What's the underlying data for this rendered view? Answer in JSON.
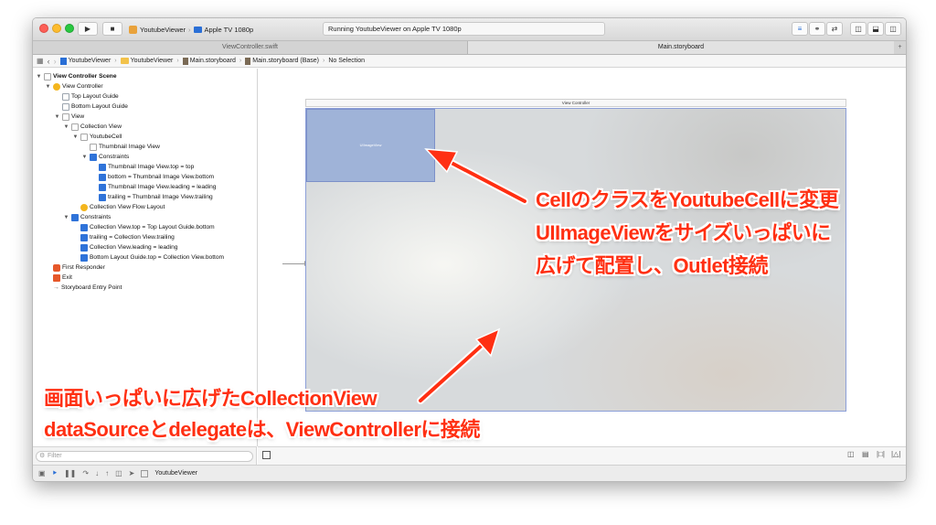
{
  "toolbar": {
    "scheme_app": "YoutubeViewer",
    "scheme_device": "Apple TV 1080p",
    "activity_text": "Running YoutubeViewer on Apple TV 1080p"
  },
  "tabs": [
    {
      "label": "ViewController.swift",
      "active": false
    },
    {
      "label": "Main.storyboard",
      "active": true
    }
  ],
  "jumpbar": {
    "crumbs": [
      "YoutubeViewer",
      "YoutubeViewer",
      "Main.storyboard",
      "Main.storyboard (Base)",
      "No Selection"
    ]
  },
  "outline": {
    "items": [
      {
        "label": "View Controller Scene",
        "icon": "scene-icon"
      },
      {
        "label": "View Controller",
        "icon": "view-controller-icon"
      },
      {
        "label": "Top Layout Guide",
        "icon": "layout-guide-icon"
      },
      {
        "label": "Bottom Layout Guide",
        "icon": "layout-guide-icon"
      },
      {
        "label": "View",
        "icon": "view-icon"
      },
      {
        "label": "Collection View",
        "icon": "collection-view-icon"
      },
      {
        "label": "YoutubeCell",
        "icon": "cell-icon"
      },
      {
        "label": "Thumbnail Image View",
        "icon": "image-view-icon"
      },
      {
        "label": "Constraints",
        "icon": "constraints-icon"
      },
      {
        "label": "Thumbnail Image View.top = top",
        "icon": "constraint-icon"
      },
      {
        "label": "bottom = Thumbnail Image View.bottom",
        "icon": "constraint-icon"
      },
      {
        "label": "Thumbnail Image View.leading = leading",
        "icon": "constraint-icon"
      },
      {
        "label": "trailing = Thumbnail Image View.trailing",
        "icon": "constraint-icon"
      },
      {
        "label": "Collection View Flow Layout",
        "icon": "flow-layout-icon"
      },
      {
        "label": "Constraints",
        "icon": "constraints-icon"
      },
      {
        "label": "Collection View.top = Top Layout Guide.bottom",
        "icon": "constraint-icon"
      },
      {
        "label": "trailing = Collection View.trailing",
        "icon": "constraint-icon"
      },
      {
        "label": "Collection View.leading = leading",
        "icon": "constraint-icon"
      },
      {
        "label": "Bottom Layout Guide.top = Collection View.bottom",
        "icon": "constraint-icon"
      },
      {
        "label": "First Responder",
        "icon": "first-responder-icon"
      },
      {
        "label": "Exit",
        "icon": "exit-icon"
      },
      {
        "label": "Storyboard Entry Point",
        "icon": "entry-point-icon"
      }
    ]
  },
  "canvas": {
    "scene_title": "View Controller",
    "cell_label": "UIImageView"
  },
  "filter": {
    "placeholder": "Filter"
  },
  "debugbar": {
    "target": "YoutubeViewer"
  },
  "annotations": {
    "cell_note": [
      "CellのクラスをYoutubeCellに変更",
      "UIImageViewをサイズいっぱいに",
      "広げて配置し、Outlet接続"
    ],
    "cv_note": [
      "画面いっぱいに広げたCollectionView",
      "dataSourceとdelegateは、ViewControllerに接続"
    ],
    "color": "#ff2f12"
  }
}
